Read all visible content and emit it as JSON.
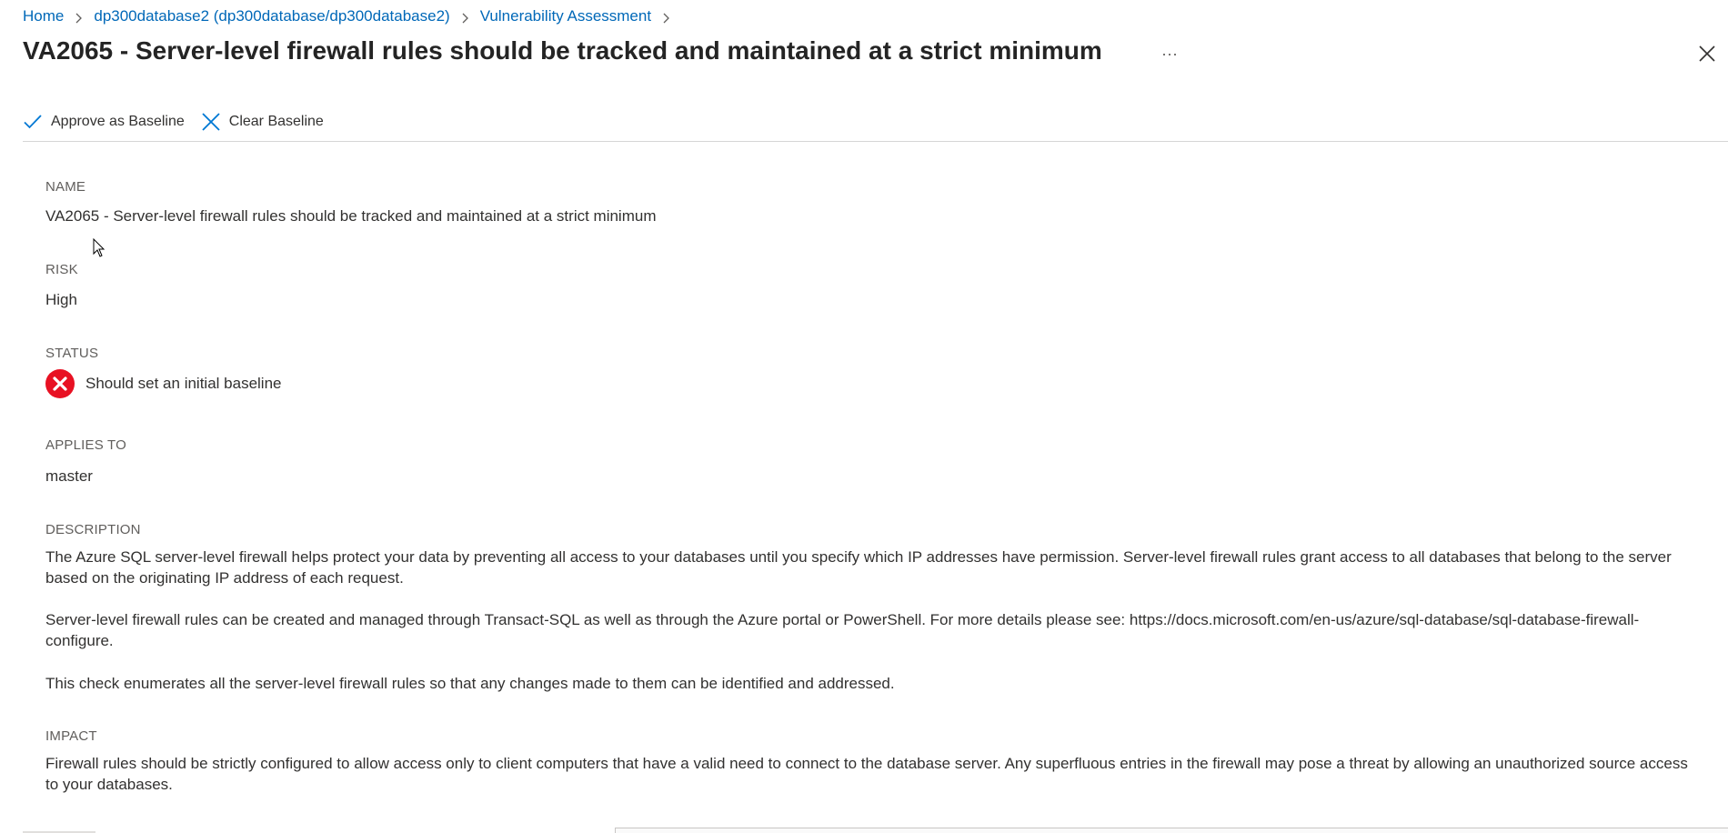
{
  "breadcrumb": {
    "items": [
      {
        "label": "Home"
      },
      {
        "label": "dp300database2 (dp300database/dp300database2)"
      },
      {
        "label": "Vulnerability Assessment"
      }
    ]
  },
  "header": {
    "title": "VA2065 - Server-level firewall rules should be tracked and maintained at a strict minimum",
    "more_label": "···"
  },
  "toolbar": {
    "approve_label": "Approve as Baseline",
    "clear_label": "Clear Baseline"
  },
  "details": {
    "name_label": "NAME",
    "name_value": "VA2065 - Server-level firewall rules should be tracked and maintained at a strict minimum",
    "risk_label": "RISK",
    "risk_value": "High",
    "status_label": "STATUS",
    "status_value": "Should set an initial baseline",
    "applies_label": "APPLIES TO",
    "applies_value": "master",
    "description_label": "DESCRIPTION",
    "description_paragraphs": [
      "The Azure SQL server-level firewall helps protect your data by preventing all access to your databases until you specify which IP addresses have permission. Server-level firewall rules grant access to all databases that belong to the server based on the originating IP address of each request.",
      "Server-level firewall rules can be created and managed through Transact-SQL as well as through the Azure portal or PowerShell. For more details please see: https://docs.microsoft.com/en-us/azure/sql-database/sql-database-firewall-configure.",
      "This check enumerates all the server-level firewall rules so that any changes made to them can be identified and addressed."
    ],
    "impact_label": "IMPACT",
    "impact_value": "Firewall rules should be strictly configured to allow access only to client computers that have a valid need to connect to the database server. Any superfluous entries in the firewall may pose a threat by allowing an unauthorized source access to your databases."
  },
  "colors": {
    "link": "#0068b8",
    "error": "#e81123",
    "accent": "#0078d4"
  },
  "icons": {
    "chevron": "chevron-right-icon",
    "more": "more-icon",
    "close": "close-icon",
    "approve": "checkmark-icon",
    "clear": "cancel-x-icon",
    "status": "error-circle-icon"
  }
}
